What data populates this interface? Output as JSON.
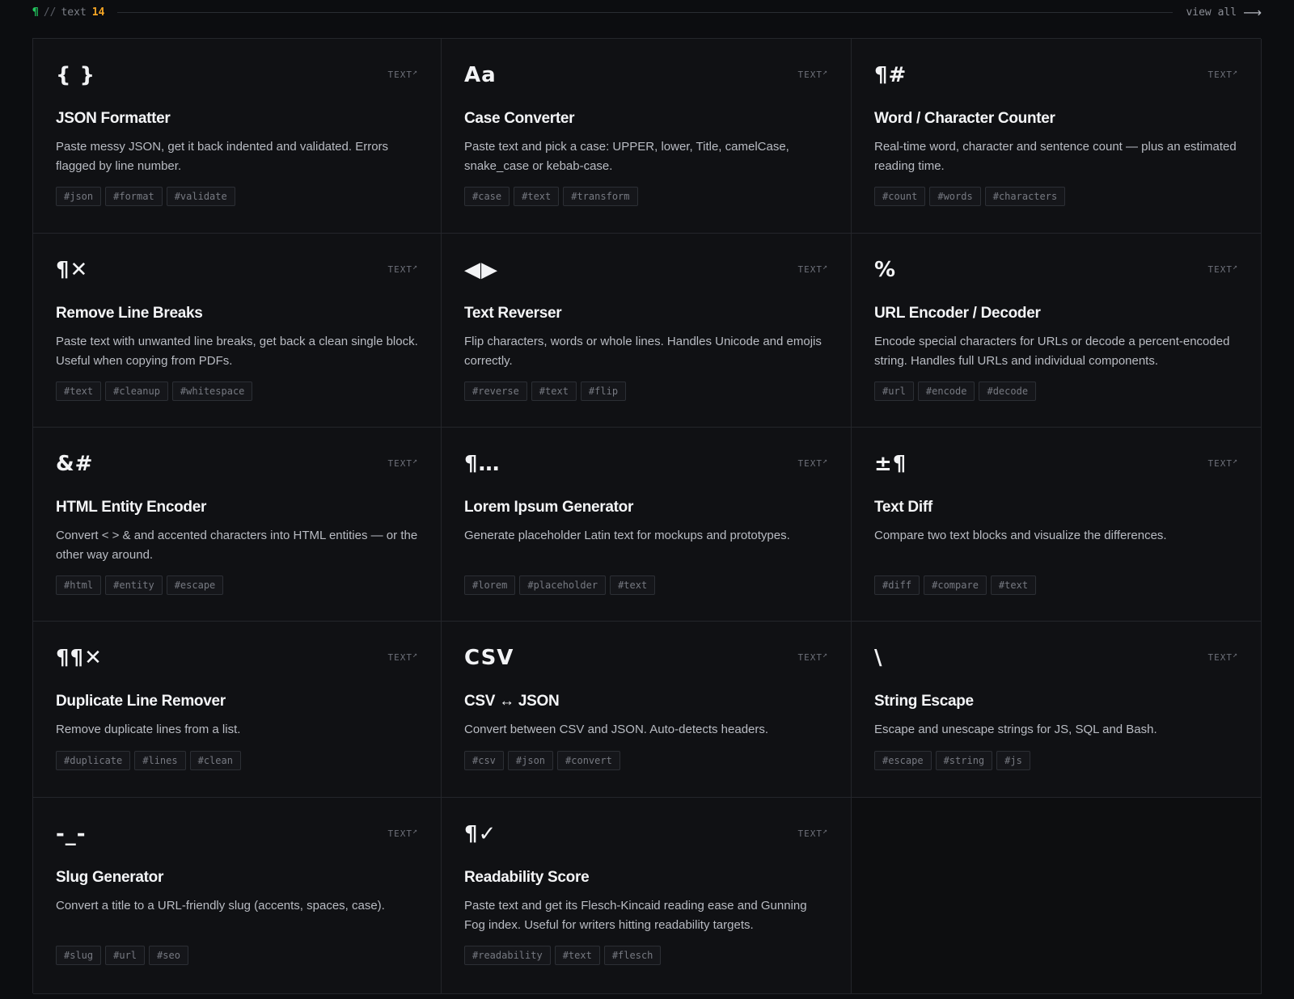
{
  "header": {
    "pilcrow": "¶",
    "slashes": "//",
    "label": "text",
    "count": "14",
    "view_all": "view all",
    "arrow": "⟶"
  },
  "category_label": "TEXT",
  "category_arrow": "↗",
  "tools": [
    {
      "icon": "{ }",
      "title": "JSON Formatter",
      "desc": "Paste messy JSON, get it back indented and validated. Errors flagged by line number.",
      "tags": [
        "#json",
        "#format",
        "#validate"
      ]
    },
    {
      "icon": "Aa",
      "title": "Case Converter",
      "desc": "Paste text and pick a case: UPPER, lower, Title, camelCase, snake_case or kebab-case.",
      "tags": [
        "#case",
        "#text",
        "#transform"
      ]
    },
    {
      "icon": "¶#",
      "title": "Word / Character Counter",
      "desc": "Real-time word, character and sentence count — plus an estimated reading time.",
      "tags": [
        "#count",
        "#words",
        "#characters"
      ]
    },
    {
      "icon": "¶✕",
      "title": "Remove Line Breaks",
      "desc": "Paste text with unwanted line breaks, get back a clean single block. Useful when copying from PDFs.",
      "tags": [
        "#text",
        "#cleanup",
        "#whitespace"
      ]
    },
    {
      "icon": "◀▶",
      "title": "Text Reverser",
      "desc": "Flip characters, words or whole lines. Handles Unicode and emojis correctly.",
      "tags": [
        "#reverse",
        "#text",
        "#flip"
      ]
    },
    {
      "icon": "%",
      "title": "URL Encoder / Decoder",
      "desc": "Encode special characters for URLs or decode a percent-encoded string. Handles full URLs and individual components.",
      "tags": [
        "#url",
        "#encode",
        "#decode"
      ]
    },
    {
      "icon": "&#",
      "title": "HTML Entity Encoder",
      "desc": "Convert < > & and accented characters into HTML entities — or the other way around.",
      "tags": [
        "#html",
        "#entity",
        "#escape"
      ]
    },
    {
      "icon": "¶…",
      "title": "Lorem Ipsum Generator",
      "desc": "Generate placeholder Latin text for mockups and prototypes.",
      "tags": [
        "#lorem",
        "#placeholder",
        "#text"
      ]
    },
    {
      "icon": "±¶",
      "title": "Text Diff",
      "desc": "Compare two text blocks and visualize the differences.",
      "tags": [
        "#diff",
        "#compare",
        "#text"
      ]
    },
    {
      "icon": "¶¶✕",
      "title": "Duplicate Line Remover",
      "desc": "Remove duplicate lines from a list.",
      "tags": [
        "#duplicate",
        "#lines",
        "#clean"
      ]
    },
    {
      "icon": "CSV",
      "title": "CSV ↔ JSON",
      "desc": "Convert between CSV and JSON. Auto-detects headers.",
      "tags": [
        "#csv",
        "#json",
        "#convert"
      ]
    },
    {
      "icon": "\\",
      "title": "String Escape",
      "desc": "Escape and unescape strings for JS, SQL and Bash.",
      "tags": [
        "#escape",
        "#string",
        "#js"
      ]
    },
    {
      "icon": "-_-",
      "title": "Slug Generator",
      "desc": "Convert a title to a URL-friendly slug (accents, spaces, case).",
      "tags": [
        "#slug",
        "#url",
        "#seo"
      ]
    },
    {
      "icon": "¶✓",
      "title": "Readability Score",
      "desc": "Paste text and get its Flesch-Kincaid reading ease and Gunning Fog index. Useful for writers hitting readability targets.",
      "tags": [
        "#readability",
        "#text",
        "#flesch"
      ]
    }
  ]
}
